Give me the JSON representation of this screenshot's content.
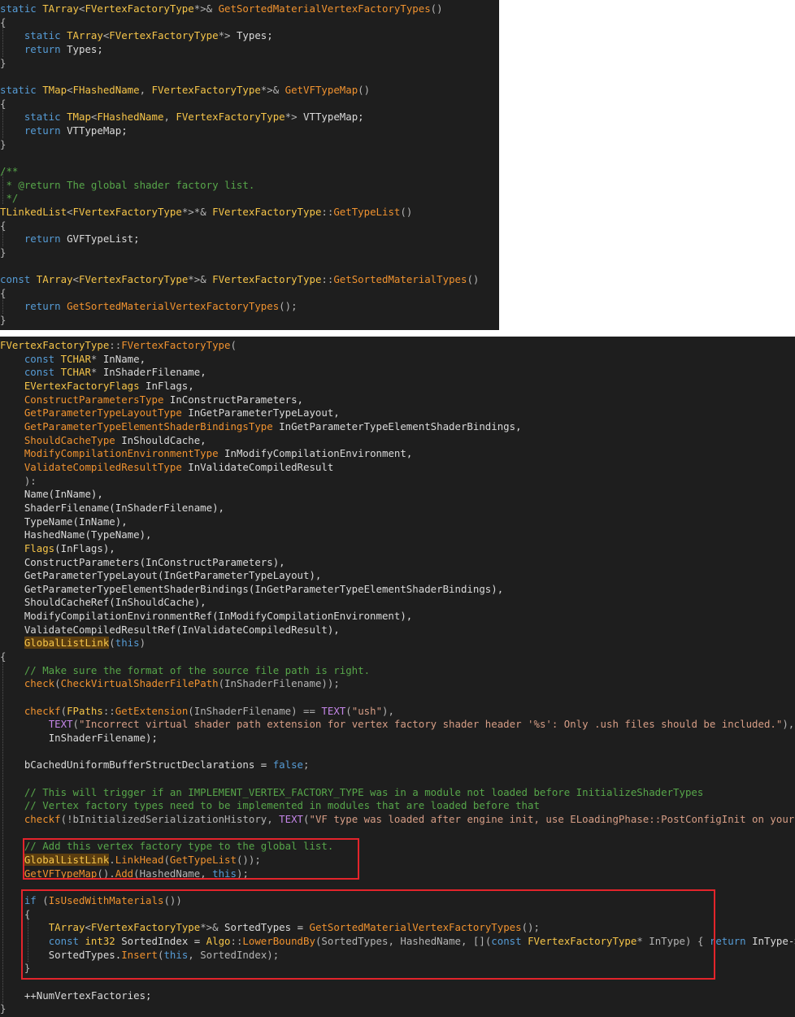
{
  "panel1": {
    "lines": [
      [
        [
          "kw",
          "static "
        ],
        [
          "ty",
          "TArray"
        ],
        [
          "pn",
          "<"
        ],
        [
          "ty",
          "FVertexFactoryType"
        ],
        [
          "pn",
          "*>& "
        ],
        [
          "fn",
          "GetSortedMaterialVertexFactoryTypes"
        ],
        [
          "pn",
          "()"
        ]
      ],
      [
        [
          "pn",
          "{"
        ]
      ],
      [
        [
          "pn",
          "    "
        ],
        [
          "kw",
          "static "
        ],
        [
          "ty",
          "TArray"
        ],
        [
          "pn",
          "<"
        ],
        [
          "ty",
          "FVertexFactoryType"
        ],
        [
          "pn",
          "*> "
        ],
        [
          "tx",
          "Types;"
        ]
      ],
      [
        [
          "pn",
          "    "
        ],
        [
          "kw",
          "return "
        ],
        [
          "tx",
          "Types;"
        ]
      ],
      [
        [
          "pn",
          "}"
        ]
      ],
      [
        [
          "tx",
          ""
        ]
      ],
      [
        [
          "kw",
          "static "
        ],
        [
          "ty",
          "TMap"
        ],
        [
          "pn",
          "<"
        ],
        [
          "ty",
          "FHashedName"
        ],
        [
          "pn",
          ", "
        ],
        [
          "ty",
          "FVertexFactoryType"
        ],
        [
          "pn",
          "*>& "
        ],
        [
          "fn",
          "GetVFTypeMap"
        ],
        [
          "pn",
          "()"
        ]
      ],
      [
        [
          "pn",
          "{"
        ]
      ],
      [
        [
          "pn",
          "    "
        ],
        [
          "kw",
          "static "
        ],
        [
          "ty",
          "TMap"
        ],
        [
          "pn",
          "<"
        ],
        [
          "ty",
          "FHashedName"
        ],
        [
          "pn",
          ", "
        ],
        [
          "ty",
          "FVertexFactoryType"
        ],
        [
          "pn",
          "*> "
        ],
        [
          "tx",
          "VTTypeMap;"
        ]
      ],
      [
        [
          "pn",
          "    "
        ],
        [
          "kw",
          "return "
        ],
        [
          "tx",
          "VTTypeMap;"
        ]
      ],
      [
        [
          "pn",
          "}"
        ]
      ],
      [
        [
          "tx",
          ""
        ]
      ],
      [
        [
          "cm",
          "/**"
        ]
      ],
      [
        [
          "cm",
          " * @return The global shader factory list."
        ]
      ],
      [
        [
          "cm",
          " */"
        ]
      ],
      [
        [
          "ty",
          "TLinkedList"
        ],
        [
          "pn",
          "<"
        ],
        [
          "ty",
          "FVertexFactoryType"
        ],
        [
          "pn",
          "*>*& "
        ],
        [
          "ty",
          "FVertexFactoryType"
        ],
        [
          "pn",
          "::"
        ],
        [
          "fn",
          "GetTypeList"
        ],
        [
          "pn",
          "()"
        ]
      ],
      [
        [
          "pn",
          "{"
        ]
      ],
      [
        [
          "pn",
          "    "
        ],
        [
          "kw",
          "return "
        ],
        [
          "tx",
          "GVFTypeList;"
        ]
      ],
      [
        [
          "pn",
          "}"
        ]
      ],
      [
        [
          "tx",
          ""
        ]
      ],
      [
        [
          "kw",
          "const "
        ],
        [
          "ty",
          "TArray"
        ],
        [
          "pn",
          "<"
        ],
        [
          "ty",
          "FVertexFactoryType"
        ],
        [
          "pn",
          "*>& "
        ],
        [
          "ty",
          "FVertexFactoryType"
        ],
        [
          "pn",
          "::"
        ],
        [
          "fn",
          "GetSortedMaterialTypes"
        ],
        [
          "pn",
          "()"
        ]
      ],
      [
        [
          "pn",
          "{"
        ]
      ],
      [
        [
          "pn",
          "    "
        ],
        [
          "kw",
          "return "
        ],
        [
          "fn",
          "GetSortedMaterialVertexFactoryTypes"
        ],
        [
          "pn",
          "();"
        ]
      ],
      [
        [
          "pn",
          "}"
        ]
      ]
    ]
  },
  "panel2": {
    "lines": [
      [
        [
          "ty",
          "FVertexFactoryType"
        ],
        [
          "pn",
          "::"
        ],
        [
          "fn",
          "FVertexFactoryType"
        ],
        [
          "pn",
          "("
        ]
      ],
      [
        [
          "pn",
          "    "
        ],
        [
          "kw",
          "const "
        ],
        [
          "ty",
          "TCHAR"
        ],
        [
          "pn",
          "* "
        ],
        [
          "tx",
          "InName,"
        ]
      ],
      [
        [
          "pn",
          "    "
        ],
        [
          "kw",
          "const "
        ],
        [
          "ty",
          "TCHAR"
        ],
        [
          "pn",
          "* "
        ],
        [
          "tx",
          "InShaderFilename,"
        ]
      ],
      [
        [
          "pn",
          "    "
        ],
        [
          "ty",
          "EVertexFactoryFlags "
        ],
        [
          "tx",
          "InFlags,"
        ]
      ],
      [
        [
          "pn",
          "    "
        ],
        [
          "fn",
          "ConstructParametersType "
        ],
        [
          "tx",
          "InConstructParameters,"
        ]
      ],
      [
        [
          "pn",
          "    "
        ],
        [
          "fn",
          "GetParameterTypeLayoutType "
        ],
        [
          "tx",
          "InGetParameterTypeLayout,"
        ]
      ],
      [
        [
          "pn",
          "    "
        ],
        [
          "fn",
          "GetParameterTypeElementShaderBindingsType "
        ],
        [
          "tx",
          "InGetParameterTypeElementShaderBindings,"
        ]
      ],
      [
        [
          "pn",
          "    "
        ],
        [
          "fn",
          "ShouldCacheType "
        ],
        [
          "tx",
          "InShouldCache,"
        ]
      ],
      [
        [
          "pn",
          "    "
        ],
        [
          "fn",
          "ModifyCompilationEnvironmentType "
        ],
        [
          "tx",
          "InModifyCompilationEnvironment,"
        ]
      ],
      [
        [
          "pn",
          "    "
        ],
        [
          "fn",
          "ValidateCompiledResultType "
        ],
        [
          "tx",
          "InValidateCompiledResult"
        ]
      ],
      [
        [
          "pn",
          "    ):"
        ]
      ],
      [
        [
          "pn",
          "    "
        ],
        [
          "tx",
          "Name(InName),"
        ]
      ],
      [
        [
          "pn",
          "    "
        ],
        [
          "tx",
          "ShaderFilename(InShaderFilename),"
        ]
      ],
      [
        [
          "pn",
          "    "
        ],
        [
          "tx",
          "TypeName(InName),"
        ]
      ],
      [
        [
          "pn",
          "    "
        ],
        [
          "tx",
          "HashedName(TypeName),"
        ]
      ],
      [
        [
          "pn",
          "    "
        ],
        [
          "ty",
          "Flags"
        ],
        [
          "tx",
          "(InFlags),"
        ]
      ],
      [
        [
          "pn",
          "    "
        ],
        [
          "tx",
          "ConstructParameters(InConstructParameters),"
        ]
      ],
      [
        [
          "pn",
          "    "
        ],
        [
          "tx",
          "GetParameterTypeLayout(InGetParameterTypeLayout),"
        ]
      ],
      [
        [
          "pn",
          "    "
        ],
        [
          "tx",
          "GetParameterTypeElementShaderBindings(InGetParameterTypeElementShaderBindings),"
        ]
      ],
      [
        [
          "pn",
          "    "
        ],
        [
          "tx",
          "ShouldCacheRef(InShouldCache),"
        ]
      ],
      [
        [
          "pn",
          "    "
        ],
        [
          "tx",
          "ModifyCompilationEnvironmentRef(InModifyCompilationEnvironment),"
        ]
      ],
      [
        [
          "pn",
          "    "
        ],
        [
          "tx",
          "ValidateCompiledResultRef(InValidateCompiledResult),"
        ]
      ],
      [
        [
          "pn",
          "    "
        ],
        [
          "hl",
          "GlobalListLink"
        ],
        [
          "pn",
          "("
        ],
        [
          "kw",
          "this"
        ],
        [
          "pn",
          ")"
        ]
      ],
      [
        [
          "pn",
          "{"
        ]
      ],
      [
        [
          "pn",
          "    "
        ],
        [
          "cm",
          "// Make sure the format of the source file path is right."
        ]
      ],
      [
        [
          "pn",
          "    "
        ],
        [
          "fn",
          "check"
        ],
        [
          "pn",
          "("
        ],
        [
          "fn",
          "CheckVirtualShaderFilePath"
        ],
        [
          "pn",
          "(InShaderFilename));"
        ]
      ],
      [
        [
          "tx",
          ""
        ]
      ],
      [
        [
          "pn",
          "    "
        ],
        [
          "fn",
          "checkf"
        ],
        [
          "pn",
          "("
        ],
        [
          "ty",
          "FPaths"
        ],
        [
          "pn",
          "::"
        ],
        [
          "fn",
          "GetExtension"
        ],
        [
          "pn",
          "(InShaderFilename) == "
        ],
        [
          "mac",
          "TEXT"
        ],
        [
          "pn",
          "("
        ],
        [
          "st",
          "\"ush\""
        ],
        [
          "pn",
          "),"
        ]
      ],
      [
        [
          "pn",
          "        "
        ],
        [
          "mac",
          "TEXT"
        ],
        [
          "pn",
          "("
        ],
        [
          "st",
          "\"Incorrect virtual shader path extension for vertex factory shader header '%s': Only .ush files should be included.\""
        ],
        [
          "pn",
          "),"
        ]
      ],
      [
        [
          "pn",
          "        "
        ],
        [
          "tx",
          "InShaderFilename);"
        ]
      ],
      [
        [
          "tx",
          ""
        ]
      ],
      [
        [
          "pn",
          "    "
        ],
        [
          "tx",
          "bCachedUniformBufferStructDeclarations = "
        ],
        [
          "kw",
          "false"
        ],
        [
          "pn",
          ";"
        ]
      ],
      [
        [
          "tx",
          ""
        ]
      ],
      [
        [
          "pn",
          "    "
        ],
        [
          "cm",
          "// This will trigger if an IMPLEMENT_VERTEX_FACTORY_TYPE was in a module not loaded before InitializeShaderTypes"
        ]
      ],
      [
        [
          "pn",
          "    "
        ],
        [
          "cm",
          "// Vertex factory types need to be implemented in modules that are loaded before that"
        ]
      ],
      [
        [
          "pn",
          "    "
        ],
        [
          "fn",
          "checkf"
        ],
        [
          "pn",
          "(!bInitializedSerializationHistory, "
        ],
        [
          "mac",
          "TEXT"
        ],
        [
          "pn",
          "("
        ],
        [
          "st",
          "\"VF type was loaded after engine init, use ELoadingPhase::PostConfigInit on your module to cause it to load earlier.\""
        ],
        [
          "pn",
          "));"
        ]
      ],
      [
        [
          "tx",
          ""
        ]
      ],
      [
        [
          "pn",
          "    "
        ],
        [
          "cm",
          "// Add this vertex factory type to the global list."
        ]
      ],
      [
        [
          "pn",
          "    "
        ],
        [
          "hl",
          "GlobalListLink"
        ],
        [
          "pn",
          "."
        ],
        [
          "fn",
          "LinkHead"
        ],
        [
          "pn",
          "("
        ],
        [
          "fn",
          "GetTypeList"
        ],
        [
          "pn",
          "());"
        ]
      ],
      [
        [
          "pn",
          "    "
        ],
        [
          "fn",
          "GetVFTypeMap"
        ],
        [
          "pn",
          "()."
        ],
        [
          "fn",
          "Add"
        ],
        [
          "pn",
          "(HashedName, "
        ],
        [
          "kw",
          "this"
        ],
        [
          "pn",
          ");"
        ]
      ],
      [
        [
          "tx",
          ""
        ]
      ],
      [
        [
          "pn",
          "    "
        ],
        [
          "kw",
          "if "
        ],
        [
          "pn",
          "("
        ],
        [
          "fn",
          "IsUsedWithMaterials"
        ],
        [
          "pn",
          "())"
        ]
      ],
      [
        [
          "pn",
          "    {"
        ]
      ],
      [
        [
          "pn",
          "        "
        ],
        [
          "ty",
          "TArray"
        ],
        [
          "pn",
          "<"
        ],
        [
          "ty",
          "FVertexFactoryType"
        ],
        [
          "pn",
          "*>& "
        ],
        [
          "tx",
          "SortedTypes = "
        ],
        [
          "fn",
          "GetSortedMaterialVertexFactoryTypes"
        ],
        [
          "pn",
          "();"
        ]
      ],
      [
        [
          "pn",
          "        "
        ],
        [
          "kw",
          "const "
        ],
        [
          "ty",
          "int32 "
        ],
        [
          "tx",
          "SortedIndex = "
        ],
        [
          "ty",
          "Algo"
        ],
        [
          "pn",
          "::"
        ],
        [
          "fn",
          "LowerBoundBy"
        ],
        [
          "pn",
          "(SortedTypes, HashedName, []("
        ],
        [
          "kw",
          "const "
        ],
        [
          "ty",
          "FVertexFactoryType"
        ],
        [
          "pn",
          "* InType) { "
        ],
        [
          "kw",
          "return "
        ],
        [
          "tx",
          "InType->GetHashedName(); });"
        ]
      ],
      [
        [
          "pn",
          "        "
        ],
        [
          "tx",
          "SortedTypes."
        ],
        [
          "fn",
          "Insert"
        ],
        [
          "pn",
          "("
        ],
        [
          "kw",
          "this"
        ],
        [
          "pn",
          ", SortedIndex);"
        ]
      ],
      [
        [
          "pn",
          "    }"
        ]
      ],
      [
        [
          "tx",
          ""
        ]
      ],
      [
        [
          "pn",
          "    "
        ],
        [
          "tx",
          "++NumVertexFactories;"
        ]
      ],
      [
        [
          "pn",
          "}"
        ]
      ]
    ]
  }
}
